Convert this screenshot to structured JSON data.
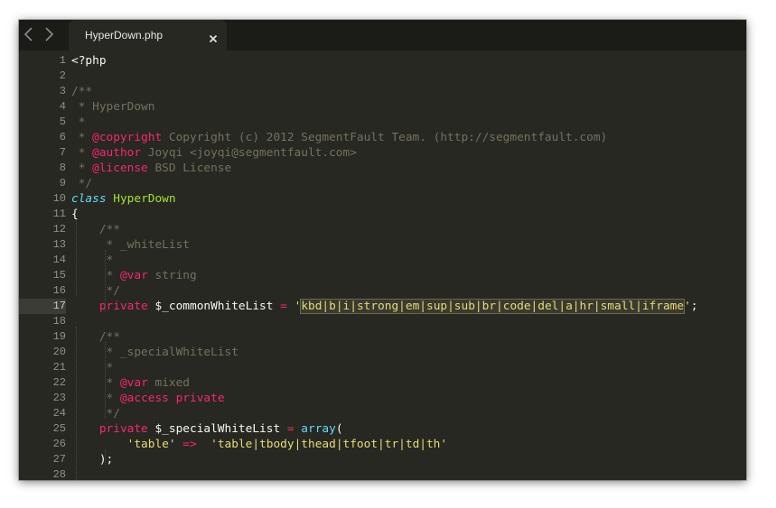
{
  "colors": {
    "background": "#272822",
    "tabbar": "#1b1c18",
    "comment": "#75715e",
    "keyword": "#f92672",
    "string": "#e6db74",
    "entity": "#a6e22e",
    "storage": "#66d9ef"
  },
  "toolbar": {
    "back_icon": "chevron-left-icon",
    "forward_icon": "chevron-right-icon"
  },
  "tab": {
    "title": "HyperDown.php",
    "close_icon": "close-icon",
    "close_glyph": "×"
  },
  "editor": {
    "current_line": 17,
    "lines": [
      {
        "num": "1",
        "tokens": [
          {
            "t": "plain",
            "v": "<?php"
          }
        ]
      },
      {
        "num": "2",
        "tokens": []
      },
      {
        "num": "3",
        "tokens": [
          {
            "t": "comment",
            "v": "/**"
          }
        ]
      },
      {
        "num": "4",
        "tokens": [
          {
            "t": "comment",
            "v": " * HyperDown"
          }
        ]
      },
      {
        "num": "5",
        "tokens": [
          {
            "t": "comment",
            "v": " *"
          }
        ]
      },
      {
        "num": "6",
        "tokens": [
          {
            "t": "comment",
            "v": " * "
          },
          {
            "t": "doctag",
            "v": "@copyright"
          },
          {
            "t": "comment",
            "v": " Copyright (c) 2012 SegmentFault Team. (http://segmentfault.com)"
          }
        ]
      },
      {
        "num": "7",
        "tokens": [
          {
            "t": "comment",
            "v": " * "
          },
          {
            "t": "doctag",
            "v": "@author"
          },
          {
            "t": "comment",
            "v": " Joyqi <joyqi@segmentfault.com>"
          }
        ]
      },
      {
        "num": "8",
        "tokens": [
          {
            "t": "comment",
            "v": " * "
          },
          {
            "t": "doctag",
            "v": "@license"
          },
          {
            "t": "comment",
            "v": " BSD License"
          }
        ]
      },
      {
        "num": "9",
        "tokens": [
          {
            "t": "comment",
            "v": " */"
          }
        ]
      },
      {
        "num": "10",
        "tokens": [
          {
            "t": "storage",
            "v": "class"
          },
          {
            "t": "plain",
            "v": " "
          },
          {
            "t": "entity",
            "v": "HyperDown"
          }
        ]
      },
      {
        "num": "11",
        "tokens": [
          {
            "t": "plain",
            "v": "{"
          }
        ]
      },
      {
        "num": "12",
        "tokens": [
          {
            "t": "plain",
            "v": "    "
          },
          {
            "t": "comment",
            "v": "/**"
          }
        ]
      },
      {
        "num": "13",
        "tokens": [
          {
            "t": "plain",
            "v": "    "
          },
          {
            "t": "comment",
            "v": " * _whiteList"
          }
        ]
      },
      {
        "num": "14",
        "tokens": [
          {
            "t": "plain",
            "v": "    "
          },
          {
            "t": "comment",
            "v": " *"
          }
        ]
      },
      {
        "num": "15",
        "tokens": [
          {
            "t": "plain",
            "v": "    "
          },
          {
            "t": "comment",
            "v": " * "
          },
          {
            "t": "doctag",
            "v": "@var"
          },
          {
            "t": "comment",
            "v": " string"
          }
        ]
      },
      {
        "num": "16",
        "tokens": [
          {
            "t": "plain",
            "v": "    "
          },
          {
            "t": "comment",
            "v": " */"
          }
        ]
      },
      {
        "num": "17",
        "tokens": [
          {
            "t": "plain",
            "v": "    "
          },
          {
            "t": "keyword",
            "v": "private"
          },
          {
            "t": "plain",
            "v": " $_commonWhiteList "
          },
          {
            "t": "keyword",
            "v": "="
          },
          {
            "t": "plain",
            "v": " "
          },
          {
            "t": "string",
            "v": "'"
          },
          {
            "t": "hl",
            "v": "kbd|b|i|strong|em|sup|sub|br|code|del|a|hr|small|iframe"
          },
          {
            "t": "string",
            "v": "'"
          },
          {
            "t": "plain",
            "v": ";"
          }
        ]
      },
      {
        "num": "18",
        "tokens": []
      },
      {
        "num": "19",
        "tokens": [
          {
            "t": "plain",
            "v": "    "
          },
          {
            "t": "comment",
            "v": "/**"
          }
        ]
      },
      {
        "num": "20",
        "tokens": [
          {
            "t": "plain",
            "v": "    "
          },
          {
            "t": "comment",
            "v": " * _specialWhiteList"
          }
        ]
      },
      {
        "num": "21",
        "tokens": [
          {
            "t": "plain",
            "v": "    "
          },
          {
            "t": "comment",
            "v": " *"
          }
        ]
      },
      {
        "num": "22",
        "tokens": [
          {
            "t": "plain",
            "v": "    "
          },
          {
            "t": "comment",
            "v": " * "
          },
          {
            "t": "doctag",
            "v": "@var"
          },
          {
            "t": "comment",
            "v": " mixed"
          }
        ]
      },
      {
        "num": "23",
        "tokens": [
          {
            "t": "plain",
            "v": "    "
          },
          {
            "t": "comment",
            "v": " * "
          },
          {
            "t": "doctag",
            "v": "@access private"
          }
        ]
      },
      {
        "num": "24",
        "tokens": [
          {
            "t": "plain",
            "v": "    "
          },
          {
            "t": "comment",
            "v": " */"
          }
        ]
      },
      {
        "num": "25",
        "tokens": [
          {
            "t": "plain",
            "v": "    "
          },
          {
            "t": "keyword",
            "v": "private"
          },
          {
            "t": "plain",
            "v": " $_specialWhiteList "
          },
          {
            "t": "keyword",
            "v": "="
          },
          {
            "t": "plain",
            "v": " "
          },
          {
            "t": "func",
            "v": "array"
          },
          {
            "t": "plain",
            "v": "("
          }
        ]
      },
      {
        "num": "26",
        "tokens": [
          {
            "t": "plain",
            "v": "        "
          },
          {
            "t": "string",
            "v": "'table'"
          },
          {
            "t": "plain",
            "v": " "
          },
          {
            "t": "keyword",
            "v": "=>"
          },
          {
            "t": "plain",
            "v": "  "
          },
          {
            "t": "string",
            "v": "'table|tbody|thead|tfoot|tr|td|th'"
          }
        ]
      },
      {
        "num": "27",
        "tokens": [
          {
            "t": "plain",
            "v": "    );"
          }
        ]
      },
      {
        "num": "28",
        "tokens": []
      }
    ]
  }
}
